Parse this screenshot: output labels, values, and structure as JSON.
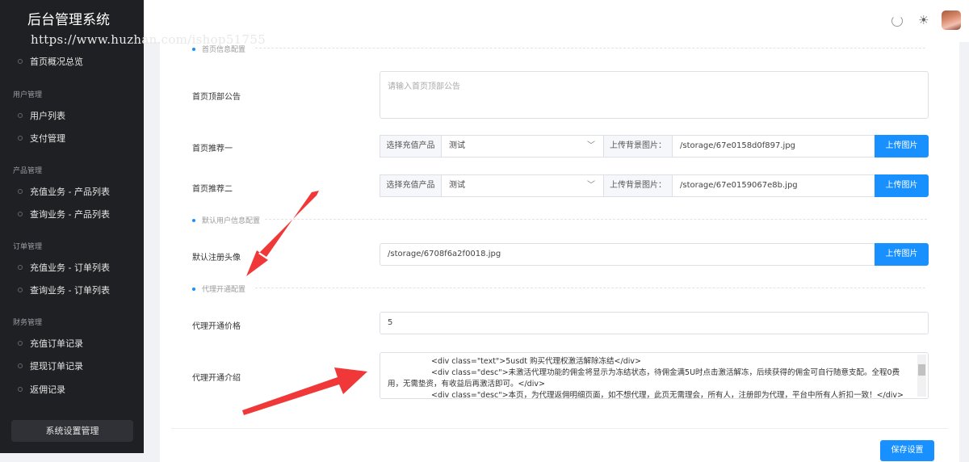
{
  "app": {
    "title": "后台管理系统",
    "watermark": "https://www.huzhan.com/ishop51755"
  },
  "sidebar": {
    "overview": "首页概况总览",
    "groups": [
      {
        "title": "用户管理",
        "items": [
          "用户列表",
          "支付管理"
        ]
      },
      {
        "title": "产品管理",
        "items": [
          "充值业务 - 产品列表",
          "查询业务 - 产品列表"
        ]
      },
      {
        "title": "订单管理",
        "items": [
          "充值业务 - 订单列表",
          "查询业务 - 订单列表"
        ]
      },
      {
        "title": "财务管理",
        "items": [
          "充值订单记录",
          "提现订单记录",
          "返佣记录"
        ]
      }
    ],
    "system_button": "系统设置管理"
  },
  "header": {
    "refresh_icon": "refresh-icon",
    "theme_icon": "sun-icon",
    "avatar": "user-avatar"
  },
  "form": {
    "section_home": "首页信息配置",
    "notice": {
      "label": "首页顶部公告",
      "placeholder": "请输入首页顶部公告"
    },
    "rec1": {
      "label": "首页推荐一",
      "addon": "选择充值产品",
      "select": "测试",
      "bg_addon": "上传背景图片：",
      "path": "/storage/67e0158d0f897.jpg",
      "upload": "上传图片"
    },
    "rec2": {
      "label": "首页推荐二",
      "addon": "选择充值产品",
      "select": "测试",
      "bg_addon": "上传背景图片：",
      "path": "/storage/67e0159067e8b.jpg",
      "upload": "上传图片"
    },
    "section_user": "默认用户信息配置",
    "avatar": {
      "label": "默认注册头像",
      "path": "/storage/6708f6a2f0018.jpg",
      "upload": "上传图片"
    },
    "section_agent": "代理开通配置",
    "agent_price": {
      "label": "代理开通价格",
      "value": "5"
    },
    "agent_intro": {
      "label": "代理开通介绍",
      "lines": [
        "<div class=\"text\">5usdt 购买代理权激活解除冻结</div>",
        "<div class=\"desc\">未激活代理功能的佣金将显示为冻结状态，待佣金满5U时点击激活解冻，后续获得的佣金可自行随意支配。全程0费",
        "用，无需垫资，有收益后再激活即可。</div>",
        "<div class=\"desc\">本页，为代理返佣明细页面，如不想代理，此页无需理会，所有人，注册即为代理，平台中所有人折扣一致！</div>"
      ]
    },
    "save": "保存设置"
  }
}
